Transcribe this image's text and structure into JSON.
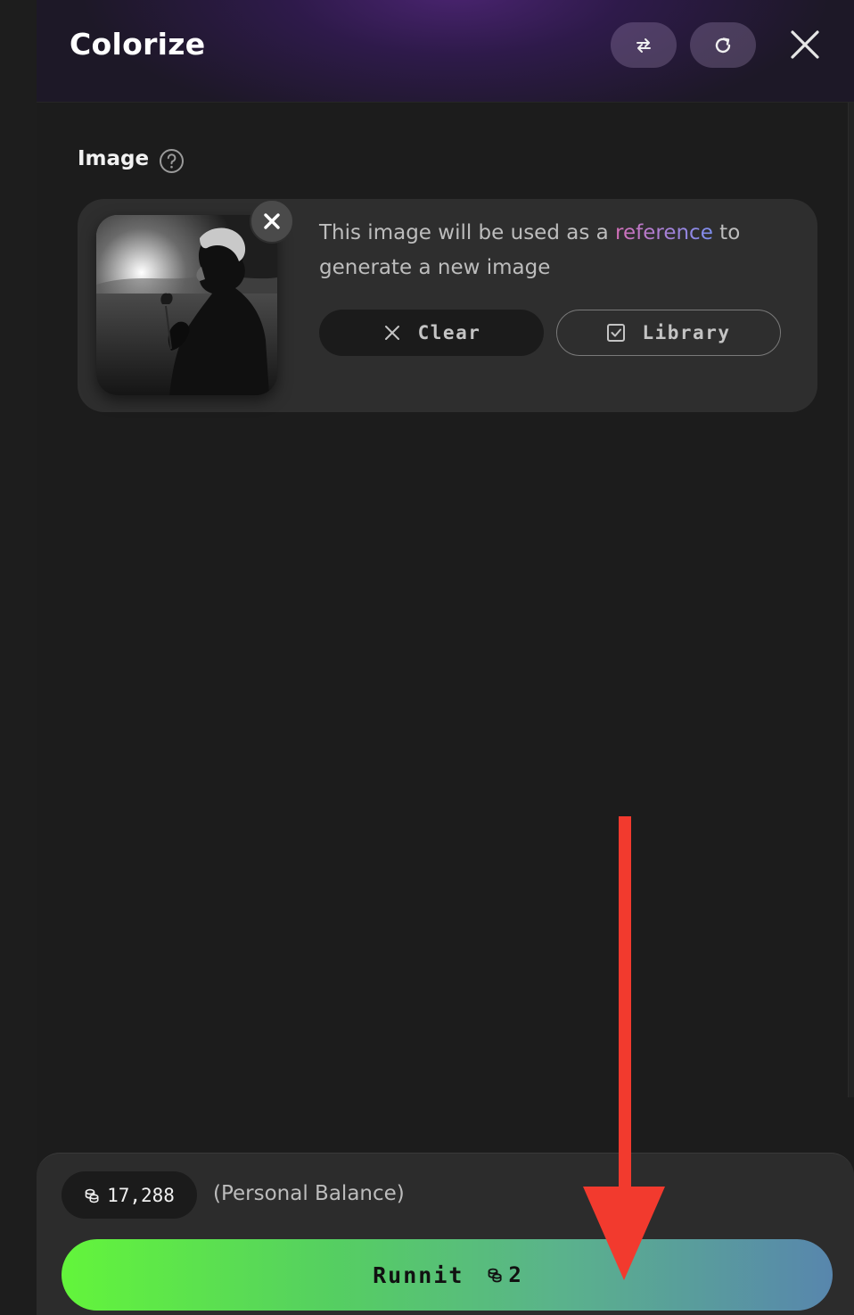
{
  "panel": {
    "title": "Colorize",
    "header_buttons": [
      "swap-icon",
      "refresh-icon",
      "close-icon"
    ]
  },
  "image_section": {
    "label": "Image",
    "help_icon": "question-circle-icon",
    "description_before": "This image will be used as a ",
    "description_accent": "reference",
    "description_after": " to generate a new image",
    "clear_label": "Clear",
    "library_label": "Library",
    "thumbnail_alt": "Black and white photo of a woman holding a rose in a field at sunset"
  },
  "footer": {
    "balance": "17,288",
    "balance_label": "(Personal Balance)",
    "run_label": "Runnit",
    "run_cost": "2"
  },
  "colors": {
    "accent_gradient_start": "#63f53b",
    "accent_gradient_end": "#5886ad",
    "annotation_arrow": "#f23a2e",
    "reference_text_start": "#d36fb8",
    "reference_text_end": "#7d8ff0"
  }
}
